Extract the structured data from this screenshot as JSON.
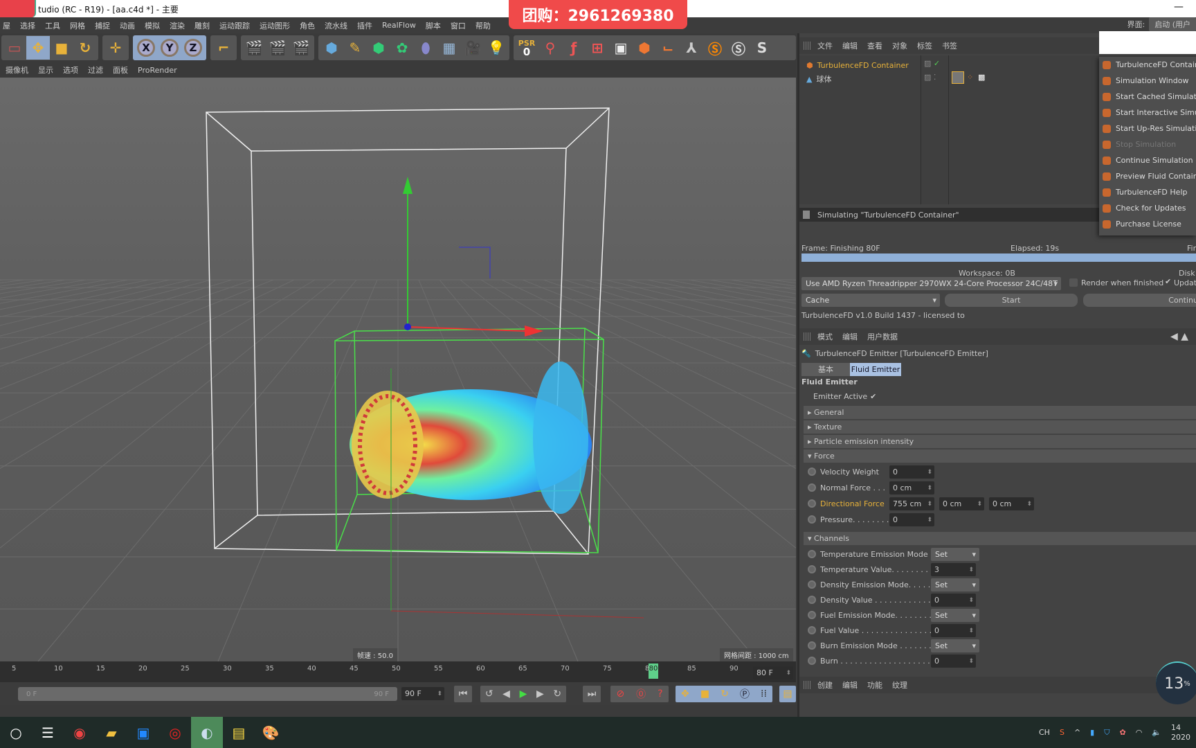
{
  "window": {
    "title": "tudio (RC - R19) - [aa.c4d *] - 主要",
    "minimize": "—"
  },
  "promo": "团购：2961269380",
  "menu": [
    "屋",
    "选择",
    "工具",
    "网格",
    "捕捉",
    "动画",
    "模拟",
    "渲染",
    "雕刻",
    "运动跟踪",
    "运动图形",
    "角色",
    "流水线",
    "插件",
    "RealFlow",
    "脚本",
    "窗口",
    "帮助"
  ],
  "interface": {
    "label": "界面:",
    "value": "启动 (用户"
  },
  "toolbar": {
    "axes": [
      "X",
      "Y",
      "Z"
    ],
    "psr": "PSR",
    "psr_value": "0"
  },
  "viewport": {
    "menu": [
      "摄像机",
      "显示",
      "选项",
      "过滤",
      "面板",
      "ProRender"
    ],
    "fps": "帧速 : 50.0",
    "grid": "网格间距 : 1000 cm"
  },
  "timeline": {
    "ticks": [
      "5",
      "10",
      "15",
      "20",
      "25",
      "30",
      "35",
      "40",
      "45",
      "50",
      "55",
      "60",
      "65",
      "70",
      "75",
      "80",
      "85",
      "90"
    ],
    "current": "80",
    "current_field": "80 F",
    "range_start": "0 F",
    "range_end": "90 F",
    "end_field": "90 F"
  },
  "object_manager": {
    "menu": [
      "文件",
      "编辑",
      "查看",
      "对象",
      "标签",
      "书签"
    ],
    "items": [
      {
        "name": "TurbulenceFD Container",
        "selected": true
      },
      {
        "name": "球体",
        "selected": false
      }
    ]
  },
  "popup_menu": [
    {
      "label": "TurbulenceFD Container",
      "enabled": true
    },
    {
      "label": "Simulation Window",
      "enabled": true
    },
    {
      "label": "Start Cached Simulation",
      "enabled": true
    },
    {
      "label": "Start Interactive Simulation",
      "enabled": true
    },
    {
      "label": "Start Up-Res Simulation",
      "enabled": true
    },
    {
      "label": "Stop Simulation",
      "enabled": false
    },
    {
      "label": "Continue Simulation",
      "enabled": true
    },
    {
      "label": "Preview Fluid Container",
      "enabled": true
    },
    {
      "label": "TurbulenceFD Help",
      "enabled": true
    },
    {
      "label": "Check for Updates",
      "enabled": true
    },
    {
      "label": "Purchase License",
      "enabled": true
    }
  ],
  "simulation": {
    "title": "Simulating \"TurbulenceFD Container\"",
    "frame": "Frame: Finishing 80F",
    "elapsed": "Elapsed: 19s",
    "finish": "Fin",
    "progress": 100,
    "workspace": "Workspace: 0B",
    "disk": "Disk",
    "processor": "Use  AMD Ryzen Threadripper 2970WX 24-Core Processor 24C/48T",
    "render_when_finished": "Render when finished",
    "render_checked": false,
    "update": "Update",
    "update_checked": true,
    "mode": "Cache",
    "start": "Start",
    "continue": "Continu",
    "version": "TurbulenceFD v1.0 Build 1437 - licensed to"
  },
  "attributes": {
    "menu": [
      "模式",
      "编辑",
      "用户数据"
    ],
    "object_title": "TurbulenceFD Emitter [TurbulenceFD Emitter]",
    "tabs": [
      "基本",
      "Fluid Emitter"
    ],
    "active_tab": "Fluid Emitter",
    "section": "Fluid Emitter",
    "emitter_active": "Emitter Active",
    "emitter_active_checked": true,
    "groups": {
      "general": "General",
      "texture": "Texture",
      "particle": "Particle emission intensity",
      "force": "Force",
      "channels": "Channels"
    },
    "force": [
      {
        "label": "Velocity Weight",
        "values": [
          "0"
        ]
      },
      {
        "label": "Normal Force . . .",
        "values": [
          "0 cm"
        ]
      },
      {
        "label": "Directional Force",
        "values": [
          "755 cm",
          "0 cm",
          "0 cm"
        ],
        "highlight": true
      },
      {
        "label": "Pressure. . . . . . . .",
        "values": [
          "0"
        ]
      }
    ],
    "channels": [
      {
        "label": "Temperature Emission Mode",
        "value": "Set",
        "type": "dropdown"
      },
      {
        "label": "Temperature Value. . . . . . . . .",
        "value": "3",
        "type": "number"
      },
      {
        "label": "Density Emission Mode. . . . .",
        "value": "Set",
        "type": "dropdown"
      },
      {
        "label": "Density Value . . . . . . . . . . . .",
        "value": "0",
        "type": "number"
      },
      {
        "label": "Fuel Emission Mode. . . . . . . .",
        "value": "Set",
        "type": "dropdown"
      },
      {
        "label": "Fuel Value . . . . . . . . . . . . . . .",
        "value": "0",
        "type": "number"
      },
      {
        "label": "Burn Emission Mode . . . . . . .",
        "value": "Set",
        "type": "dropdown"
      },
      {
        "label": "Burn . . . . . . . . . . . . . . . . . . .",
        "value": "0",
        "type": "number"
      }
    ]
  },
  "material_manager": {
    "menu": [
      "创建",
      "编辑",
      "功能",
      "纹理"
    ]
  },
  "overlay_badge": {
    "value": "13",
    "unit": "%"
  },
  "tray": {
    "lang": "CH",
    "time": "14",
    "date": "2020"
  },
  "colors": {
    "accent": "#8fa7c9",
    "selected_text": "#e8b23a",
    "progress": "#8fb0d8",
    "promo": "#f04a4a"
  }
}
